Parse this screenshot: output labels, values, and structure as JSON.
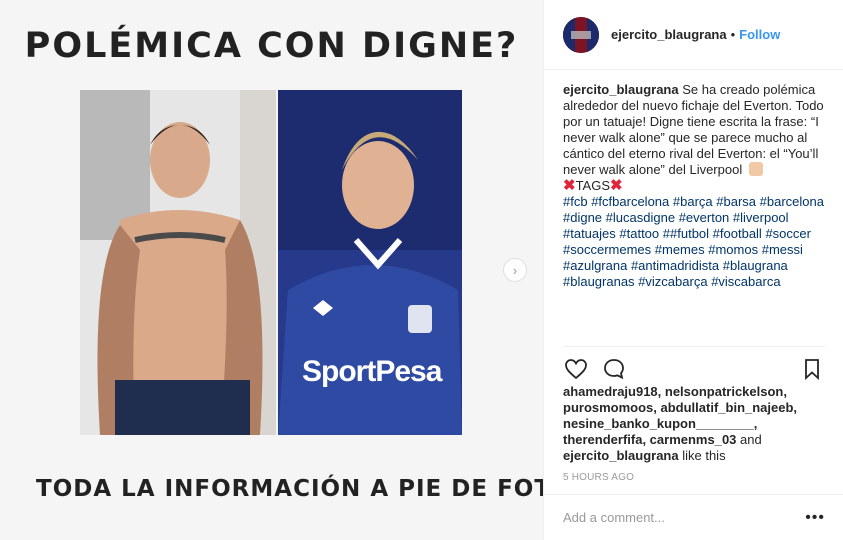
{
  "post": {
    "image_title": "POLÉMICA CON DIGNE?",
    "image_footer": "TODA LA INFORMACIÓN A PIE DE FOTO",
    "sponsor_text": "SportPesa"
  },
  "header": {
    "username": "ejercito_blaugrana",
    "separator": "•",
    "follow_label": "Follow"
  },
  "caption": {
    "username": "ejercito_blaugrana",
    "text": "Se ha creado polémica alrededor del nuevo fichaje del Everton. Todo por un tatuaje! Digne tiene escrita la frase: “I never walk alone” que se parece mucho al cántico del eterno rival del Everton: el “You’ll never walk alone” del Liverpool",
    "tags_label": "TAGS",
    "hashtags": [
      "#fcb",
      "#fcfbarcelona",
      "#barça",
      "#barsa",
      "#barcelona",
      "#digne",
      "#lucasdigne",
      "#everton",
      "#liverpool",
      "#tatuajes",
      "#tattoo",
      "##futbol",
      "#football",
      "#soccer",
      "#soccermemes",
      "#memes",
      "#momos",
      "#messi",
      "#azulgrana",
      "#antimadridista",
      "#blaugrana",
      "#blaugranas",
      "#vizcabarça",
      "#viscabarca"
    ]
  },
  "likes": {
    "line1": "ahamedraju918, nelsonpatrickelson,",
    "line2": "purosmomoos, abdullatif_bin_najeeb,",
    "line3": "nesine_banko_kupon________,",
    "line4a": "therenderfifa, carmenms_03",
    "line4b": " and",
    "line5a": "ejercito_blaugrana",
    "line5b": " like this"
  },
  "timestamp": "5 HOURS AGO",
  "comment": {
    "placeholder": "Add a comment...",
    "more_label": "•••"
  },
  "colors": {
    "follow": "#3897f0",
    "hashtag": "#003569",
    "muted": "#999999",
    "everton_blue": "#2a3f8f",
    "tag_x": "#e0243a"
  },
  "icons": {
    "like": "heart-icon",
    "comment": "comment-icon",
    "save": "bookmark-icon",
    "next": "chevron-right-icon",
    "footer_hands": "pointing-down-hand-icon"
  }
}
